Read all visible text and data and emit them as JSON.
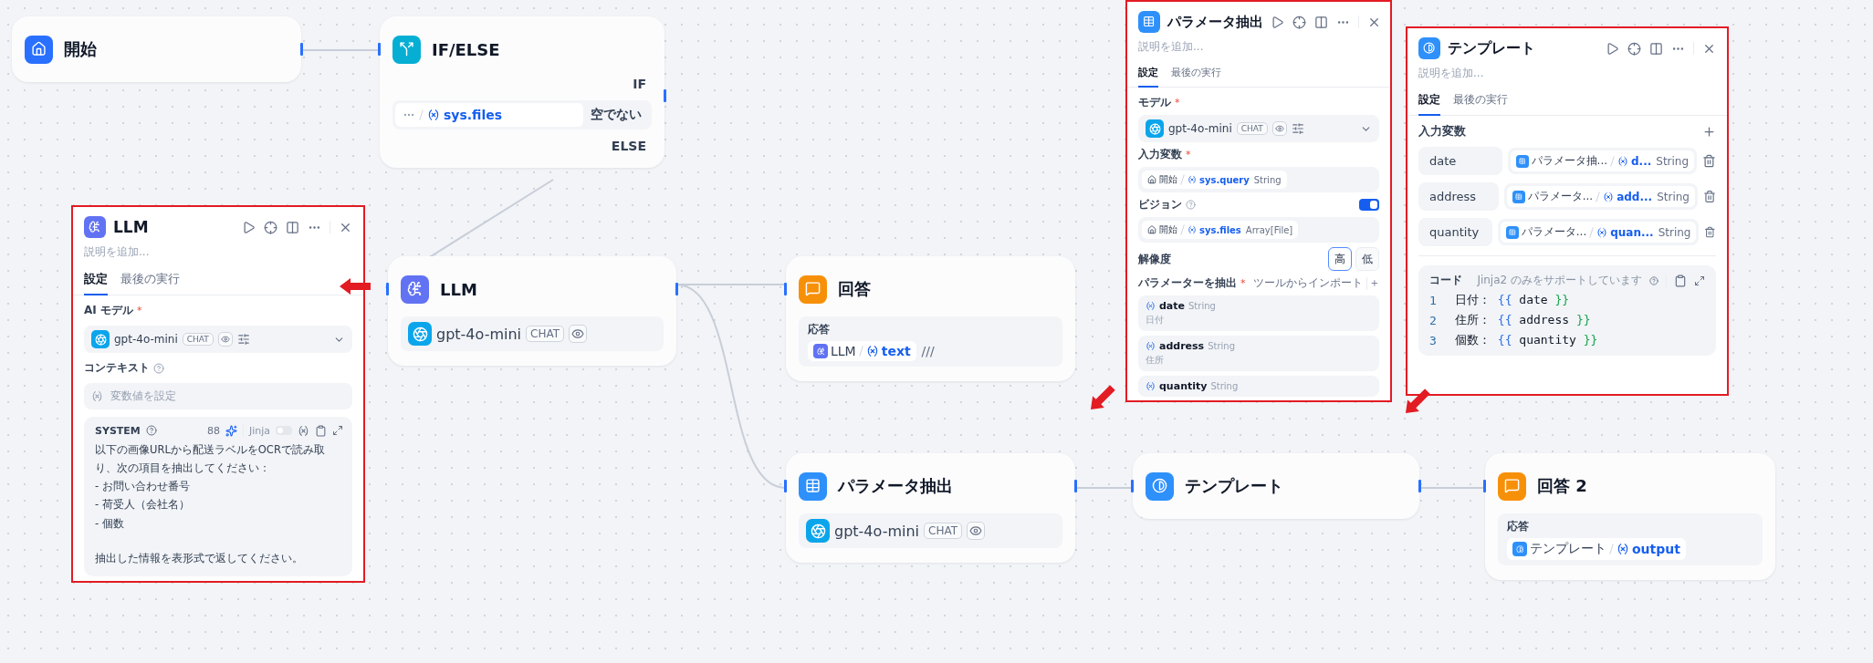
{
  "nodes": [
    {
      "kind": "start",
      "title": "開始"
    },
    {
      "kind": "ifelse",
      "title": "IF/ELSE",
      "if_label": "IF",
      "condition": {
        "variable": "sys.files",
        "operator": "空でない"
      },
      "else_label": "ELSE"
    },
    {
      "kind": "llm",
      "title": "LLM",
      "model": {
        "name": "gpt-4o-mini",
        "badge": "CHAT"
      }
    },
    {
      "kind": "answer",
      "title": "回答",
      "field_label": "応答",
      "ref": {
        "node": "LLM",
        "variable": "text"
      },
      "suffix": "///"
    },
    {
      "kind": "extractor",
      "title": "パラメータ抽出",
      "model": {
        "name": "gpt-4o-mini",
        "badge": "CHAT"
      }
    },
    {
      "kind": "template",
      "title": "テンプレート"
    },
    {
      "kind": "answer",
      "title": "回答 2",
      "field_label": "応答",
      "ref": {
        "node": "テンプレート",
        "variable": "output"
      }
    }
  ],
  "llm_panel": {
    "title": "LLM",
    "description_placeholder": "説明を追加...",
    "tabs": [
      {
        "label": "設定",
        "selected": true
      },
      {
        "label": "最後の実行",
        "selected": false
      }
    ],
    "model_label": {
      "text": "AI モデル",
      "mark": "*"
    },
    "model": {
      "name": "gpt-4o-mini",
      "badge": "CHAT"
    },
    "context_label": "コンテキスト",
    "context_placeholder": "変数値を設定",
    "prompt": {
      "role": "SYSTEM",
      "count": "88",
      "jinja_label": "Jinja",
      "jinja_on": false,
      "lines": [
        "以下の画像URLから配送ラベルをOCRで読み取り、次の項目を抽出してください：",
        "- お問い合わせ番号",
        "- 荷受人（会社名）",
        "- 個数"
      ],
      "closing": "抽出した情報を表形式で返してください。"
    }
  },
  "extractor_panel": {
    "title": "パラメータ抽出",
    "description_placeholder": "説明を追加...",
    "tabs": [
      {
        "label": "設定",
        "selected": true
      },
      {
        "label": "最後の実行",
        "selected": false
      }
    ],
    "model_label": {
      "text": "モデル",
      "mark": "*"
    },
    "model": {
      "name": "gpt-4o-mini",
      "badge": "CHAT"
    },
    "input_label": {
      "text": "入力変数",
      "mark": "*"
    },
    "input_ref": {
      "node": "開始",
      "variable": "sys.query",
      "type": "String"
    },
    "vision_label": "ビジョン",
    "vision_on": true,
    "vision_ref": {
      "node": "開始",
      "variable": "sys.files",
      "type": "Array[File]"
    },
    "resolution_label": "解像度",
    "resolution_options": [
      {
        "label": "高",
        "selected": true
      },
      {
        "label": "低",
        "selected": false
      }
    ],
    "params_label": {
      "text": "パラメーターを抽出",
      "mark": "*"
    },
    "import_label": "ツールからインポート",
    "params": [
      {
        "name": "date",
        "type": "String",
        "description": "日付"
      },
      {
        "name": "address",
        "type": "String",
        "description": "住所"
      },
      {
        "name": "quantity",
        "type": "String"
      }
    ]
  },
  "template_panel": {
    "title": "テンプレート",
    "description_placeholder": "説明を追加...",
    "tabs": [
      {
        "label": "設定",
        "selected": true
      },
      {
        "label": "最後の実行",
        "selected": false
      }
    ],
    "inputs_label": "入力変数",
    "inputs": [
      {
        "name": "date",
        "ref": {
          "node": "パラメータ抽...",
          "variable": "d...",
          "type": "String"
        }
      },
      {
        "name": "address",
        "ref": {
          "node": "パラメータ...",
          "variable": "add...",
          "type": "String"
        }
      },
      {
        "name": "quantity",
        "ref": {
          "node": "パラメータ...",
          "variable": "quan...",
          "type": "String"
        }
      }
    ],
    "code_label": "コード",
    "code_hint": "Jinja2 のみをサポートしています",
    "code_lines": [
      {
        "number": "1",
        "text": "日付：",
        "open": "{{",
        "var": "date",
        "close": "}}"
      },
      {
        "number": "2",
        "text": "住所：",
        "open": "{{",
        "var": "address",
        "close": "}}"
      },
      {
        "number": "3",
        "text": "個数：",
        "open": "{{",
        "var": "quantity",
        "close": "}}"
      }
    ]
  }
}
